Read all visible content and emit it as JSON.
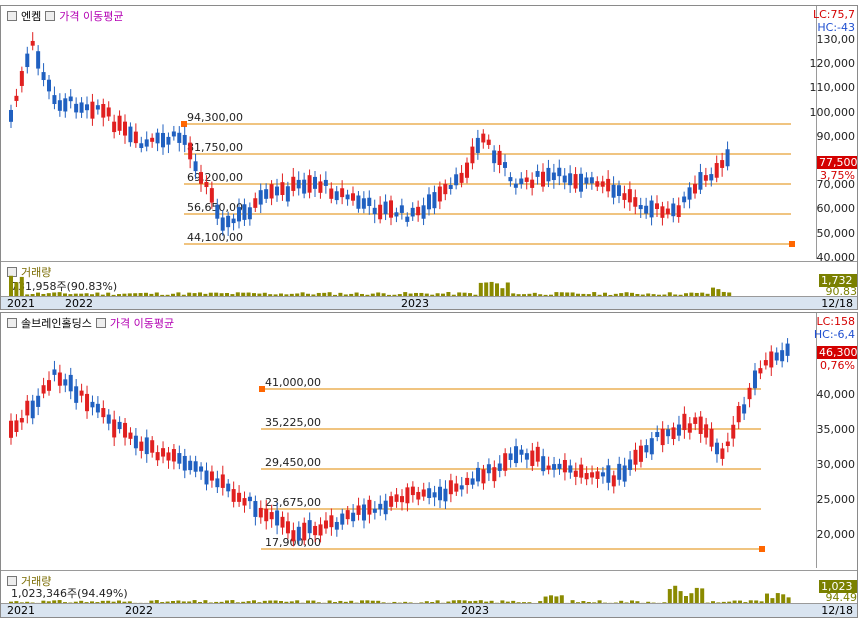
{
  "top": {
    "title": "엔켐",
    "subtitle": "가격 이동평균",
    "lc": "LC:75,7",
    "hc": "HC:-43",
    "y_labels": [
      "130,00",
      "120,000",
      "110,000",
      "100,000",
      "90,000",
      "80,000",
      "70,000",
      "60,000",
      "50,000",
      "40,000"
    ],
    "price_box": "77,500",
    "pct": "3,75%",
    "fib_levels": [
      "94,300,00",
      "81,750,00",
      "69,200,00",
      "56,650,00",
      "44,100,00"
    ],
    "volume_label": "거래량",
    "volume_value": "731,958주(90.83%)",
    "volume_box": "1,732",
    "volume_pct": "90.83",
    "time_labels": [
      "2021",
      "2022",
      "2023"
    ],
    "date_right": "12/18",
    "colors": {
      "up": "#e02020",
      "down": "#2060c0",
      "fib": "#e08a00",
      "marker": "#ff6600",
      "vol": "#8a8a00"
    }
  },
  "bottom": {
    "title": "솔브레인홀딩스",
    "subtitle": "가격 이동평균",
    "lc": "LC:158",
    "hc": "HC:-6,4",
    "y_labels": [
      "40,000",
      "35,000",
      "30,000",
      "25,000",
      "20,000"
    ],
    "price_box": "46,300",
    "pct": "0,76%",
    "fib_levels": [
      "41,000,00",
      "35,225,00",
      "29,450,00",
      "23,675,00",
      "17,900,00"
    ],
    "volume_label": "거래량",
    "volume_value": "1,023,346주(94.49%)",
    "volume_box": "1,023",
    "volume_pct": "94.49",
    "time_labels": [
      "2021",
      "2022",
      "2023"
    ],
    "date_right": "12/18"
  }
}
